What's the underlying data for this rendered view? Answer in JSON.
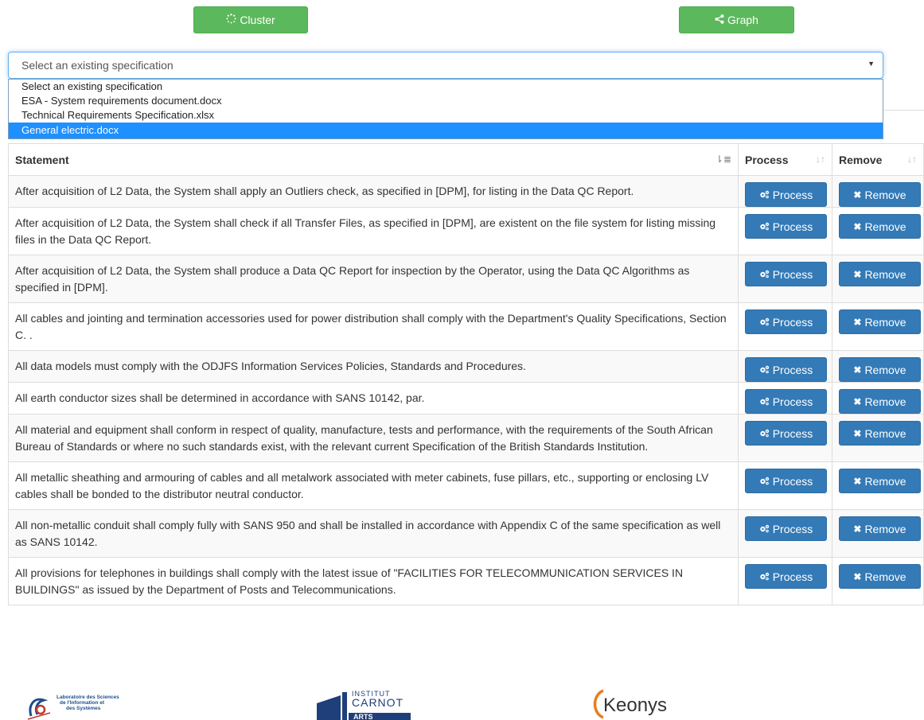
{
  "toolbar": {
    "cluster_label": "Cluster",
    "graph_label": "Graph"
  },
  "spec_select": {
    "current": "Select an existing specification",
    "options": [
      "Select an existing specification",
      "ESA - System requirements document.docx",
      "Technical Requirements Specification.xlsx",
      "General electric.docx"
    ],
    "highlighted_index": 3
  },
  "table": {
    "headers": {
      "statement": "Statement",
      "process": "Process",
      "remove": "Remove"
    },
    "process_label": "Process",
    "remove_label": "Remove",
    "rows": [
      "After acquisition of L2 Data, the System shall apply an Outliers check, as specified in [DPM], for listing in the Data QC Report.",
      "After acquisition of L2 Data, the System shall check if all Transfer Files, as specified in [DPM], are existent on the file system for listing missing files in the Data QC Report.",
      "After acquisition of L2 Data, the System shall produce a Data QC Report for inspection by the Operator, using the Data QC Algorithms as specified in [DPM].",
      "All cables and jointing and termination accessories used for power distribution shall comply with the Department's Quality Specifications, Section C. .",
      "All data models must comply with the ODJFS Information Services Policies, Standards and Procedures.",
      "All earth conductor sizes shall be determined in accordance with SANS 10142, par.",
      "All material and equipment shall conform in respect of quality, manufacture, tests and performance, with the requirements of the South African Bureau of Standards or where no such standards exist, with the relevant current Specification of the British Standards Institution.",
      "All metallic sheathing and armouring of cables and all metalwork associated with meter cabinets, fuse pillars, etc., supporting or enclosing LV cables shall be bonded to the distributor neutral conductor.",
      "All non-metallic conduit shall comply fully with SANS 950 and shall be installed in accordance with Appendix C of the same specification as well as SANS 10142.",
      "All provisions for telephones in buildings shall comply with the latest issue of \"FACILITIES FOR TELECOMMUNICATION SERVICES IN BUILDINGS\" as issued by the Department of Posts and Telecommunications."
    ]
  },
  "footer": {
    "logo_lsis": "Laboratoire des Sciences de l'Information et des Systèmes",
    "logo_carnot_line1": "INSTITUT",
    "logo_carnot_line2": "CARNOT",
    "logo_carnot_line3": "ARTS",
    "logo_keonys": "Keonys"
  },
  "colors": {
    "green": "#5cb85c",
    "blue": "#337ab7",
    "highlight": "#1e90ff"
  }
}
